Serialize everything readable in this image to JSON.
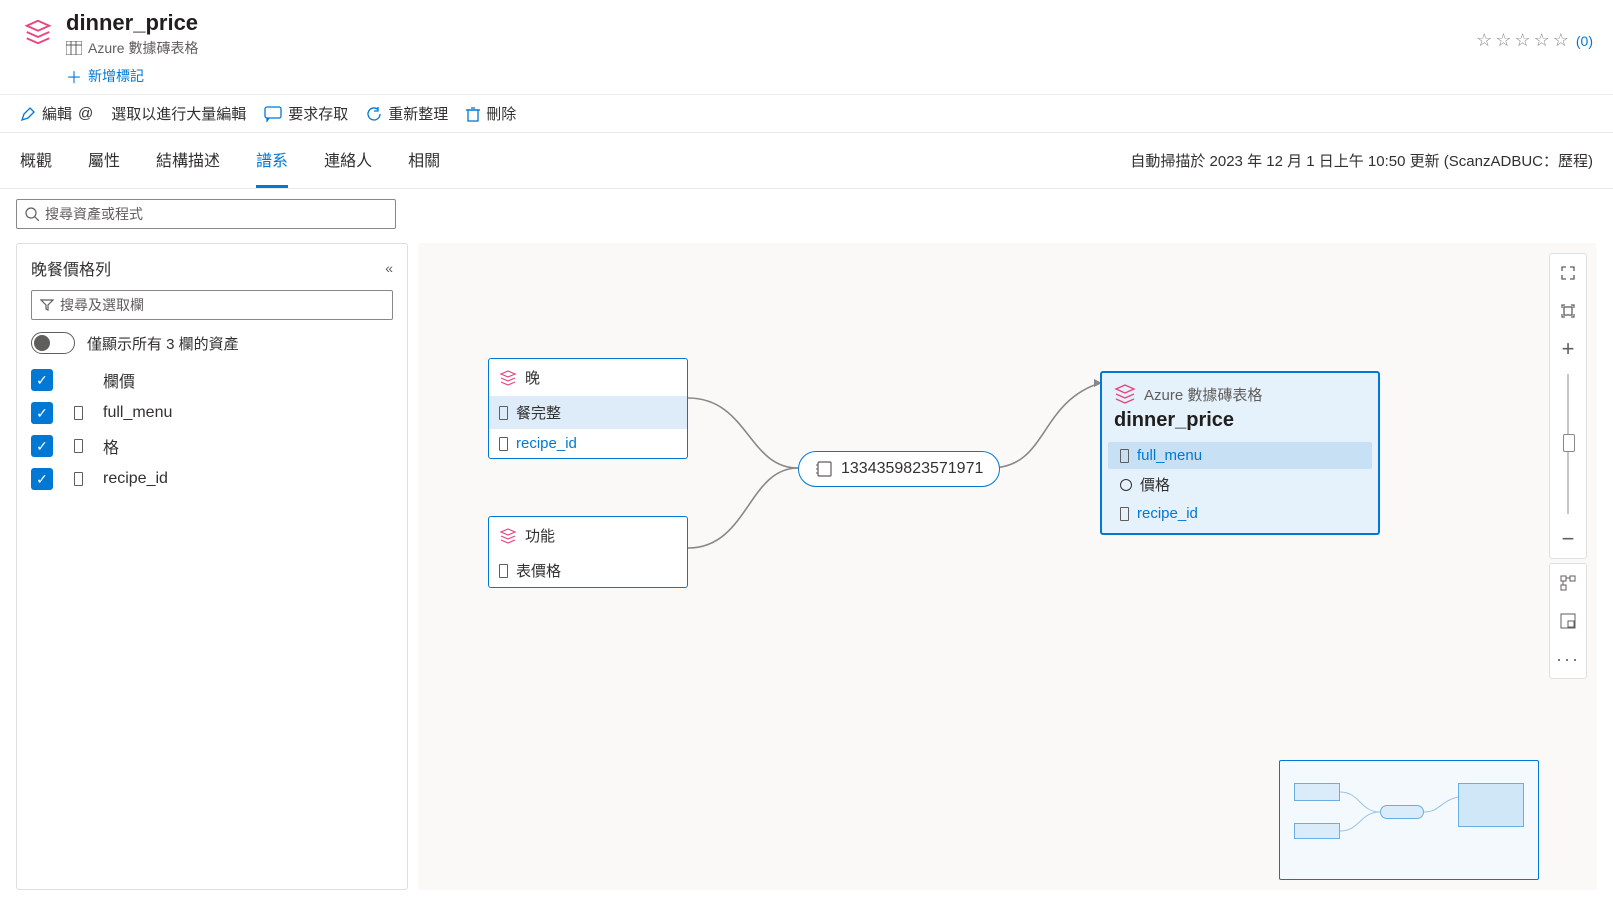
{
  "header": {
    "title": "dinner_price",
    "subtitle": "Azure 數據磚表格",
    "add_tag": "新增標記",
    "rating_count": "(0)"
  },
  "toolbar": {
    "edit": "編輯",
    "bulk_select": "選取以進行大量編輯",
    "request_access": "要求存取",
    "refresh": "重新整理",
    "delete": "刪除"
  },
  "tabs": {
    "overview": "概觀",
    "properties": "屬性",
    "schema": "結構描述",
    "lineage": "譜系",
    "contacts": "連絡人",
    "related": "相關",
    "status": "自動掃描於 2023 年 12 月 1 日上午 10:50 更新 (ScanzADBUC：歷程)"
  },
  "search": {
    "placeholder": "搜尋資產或程式"
  },
  "panel": {
    "title": "晚餐價格列",
    "filter_placeholder": "搜尋及選取欄",
    "toggle_label": "僅顯示所有 3 欄的資產",
    "columns": [
      "欄價",
      "full_menu",
      "格",
      "recipe_id"
    ]
  },
  "lineage": {
    "source1": {
      "title": "晚",
      "rows": [
        "餐完整",
        "recipe_id"
      ]
    },
    "source2": {
      "title": "功能",
      "rows": [
        "表價格"
      ]
    },
    "process": "1334359823571971",
    "target": {
      "subtitle": "Azure 數據磚表格",
      "title": "dinner_price",
      "rows": [
        "full_menu",
        "價格",
        "recipe_id"
      ]
    }
  }
}
